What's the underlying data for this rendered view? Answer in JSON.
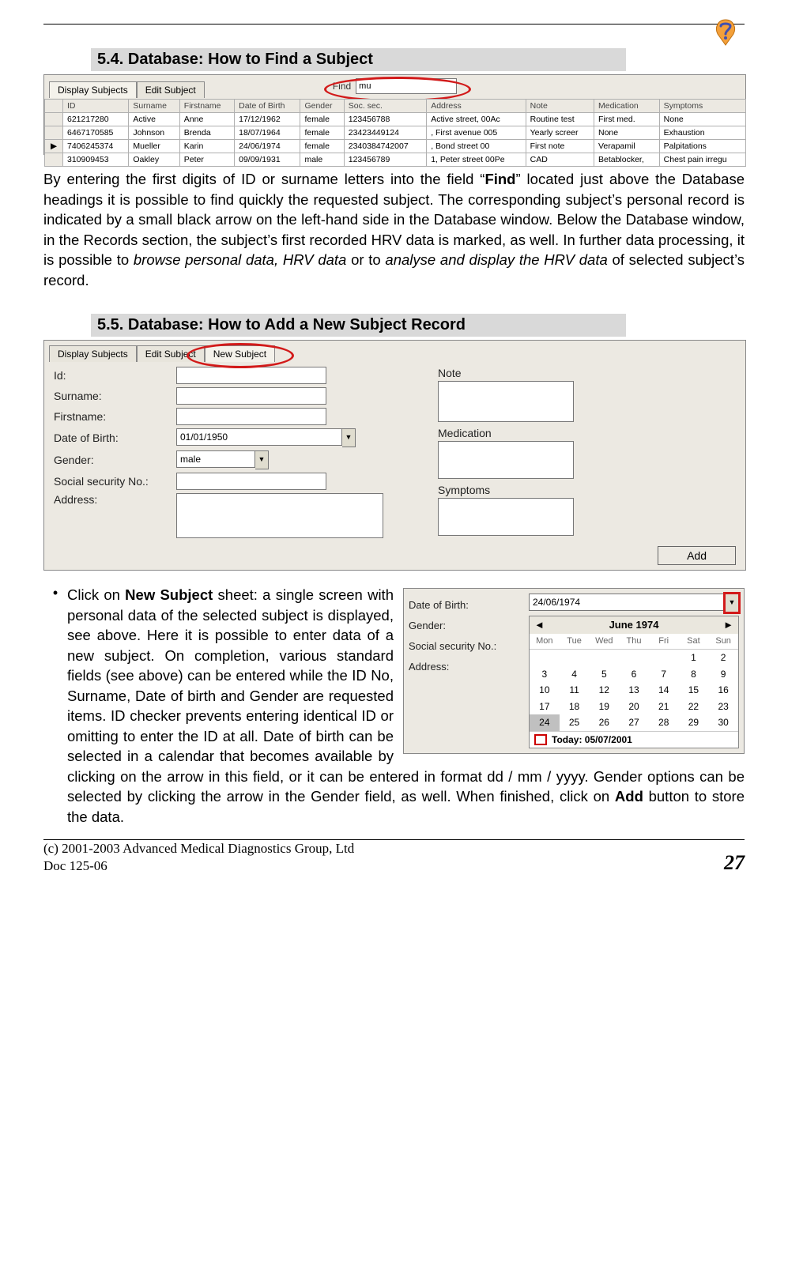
{
  "sections": {
    "s54": "5.4. Database: How to Find a Subject",
    "s55": "5.5. Database: How to Add a New Subject Record"
  },
  "sc1": {
    "tabs": [
      "Display Subjects",
      "Edit Subject"
    ],
    "find_label": "Find",
    "find_value": "mu",
    "columns": [
      "",
      "ID",
      "Surname",
      "Firstname",
      "Date of Birth",
      "Gender",
      "Soc. sec.",
      "Address",
      "Note",
      "Medication",
      "Symptoms"
    ],
    "rows": [
      [
        "",
        "621217280",
        "Active",
        "Anne",
        "17/12/1962",
        "female",
        "123456788",
        "Active street, 00Ac",
        "Routine test",
        "First med.",
        "None"
      ],
      [
        "",
        "6467170585",
        "Johnson",
        "Brenda",
        "18/07/1964",
        "female",
        "23423449124",
        ", First avenue 005",
        "Yearly screer",
        "None",
        "Exhaustion"
      ],
      [
        "▶",
        "7406245374",
        "Mueller",
        "Karin",
        "24/06/1974",
        "female",
        "2340384742007",
        ", Bond street 00",
        "First note",
        "Verapamil",
        "Palpitations"
      ],
      [
        "",
        "310909453",
        "Oakley",
        "Peter",
        "09/09/1931",
        "male",
        "123456789",
        "1, Peter street 00Pe",
        "CAD",
        "Betablocker,",
        "Chest pain irregu"
      ]
    ]
  },
  "para54_parts": {
    "a": "By entering the first digits of ID or surname letters into the field “",
    "b": "Find",
    "c": "” located just above the Database headings it is possible to find quickly the requested subject. The corresponding subject’s personal record is indicated by a small black arrow on the left-hand side in the Database window. Below the Database window, in the Records section, the subject’s first recorded HRV data is marked, as well. In further data processing, it is possible to ",
    "d": "browse personal data, HRV data",
    "e": " or to ",
    "f": "analyse and display the HRV data",
    "g": " of selected subject’s record."
  },
  "sc2": {
    "tabs": [
      "Display Subjects",
      "Edit Subject",
      "New Subject"
    ],
    "left_labels": {
      "id": "Id:",
      "surname": "Surname:",
      "firstname": "Firstname:",
      "dob": "Date of Birth:",
      "gender": "Gender:",
      "ssn": "Social security No.:",
      "address": "Address:"
    },
    "right_labels": {
      "note": "Note",
      "medication": "Medication",
      "symptoms": "Symptoms"
    },
    "dob_value": "01/01/1950",
    "gender_value": "male",
    "add_label": "Add"
  },
  "bullet55_parts": {
    "a": "Click on ",
    "b": "New Subject",
    "c": " sheet: a single screen with personal data of the selected subject is displayed, see above. Here it is possible to enter data of a new subject. On completion, various standard fields (see above) can be entered while the ID No, Surname, Date of birth and Gender are requested items. ID checker prevents entering identical ID or omitting to enter the ID at all. Date of birth can be selected in a calendar that becomes available by clicking on the arrow in this field, or it can be entered in format  dd / mm / yyyy. Gender options can be selected by clicking the arrow in the Gender field, as well. When finished, click on ",
    "d": "Add",
    "e": " button to store the data."
  },
  "sc3": {
    "labels": {
      "dob": "Date of Birth:",
      "gender": "Gender:",
      "ssn": "Social security No.:",
      "address": "Address:"
    },
    "dob_value": "24/06/1974",
    "month_title": "June 1974",
    "prev": "◄",
    "next": "►",
    "dow": [
      "Mon",
      "Tue",
      "Wed",
      "Thu",
      "Fri",
      "Sat",
      "Sun"
    ],
    "days": [
      [
        "",
        "",
        "",
        "",
        "",
        "1",
        "2"
      ],
      [
        "3",
        "4",
        "5",
        "6",
        "7",
        "8",
        "9"
      ],
      [
        "10",
        "11",
        "12",
        "13",
        "14",
        "15",
        "16"
      ],
      [
        "17",
        "18",
        "19",
        "20",
        "21",
        "22",
        "23"
      ],
      [
        "24",
        "25",
        "26",
        "27",
        "28",
        "29",
        "30"
      ]
    ],
    "selected_day": "24",
    "today_label": "Today: 05/07/2001"
  },
  "footer": {
    "copyright": "(c) 2001-2003 Advanced Medical Diagnostics Group, Ltd",
    "doc": "Doc 125-06",
    "page": "27"
  }
}
